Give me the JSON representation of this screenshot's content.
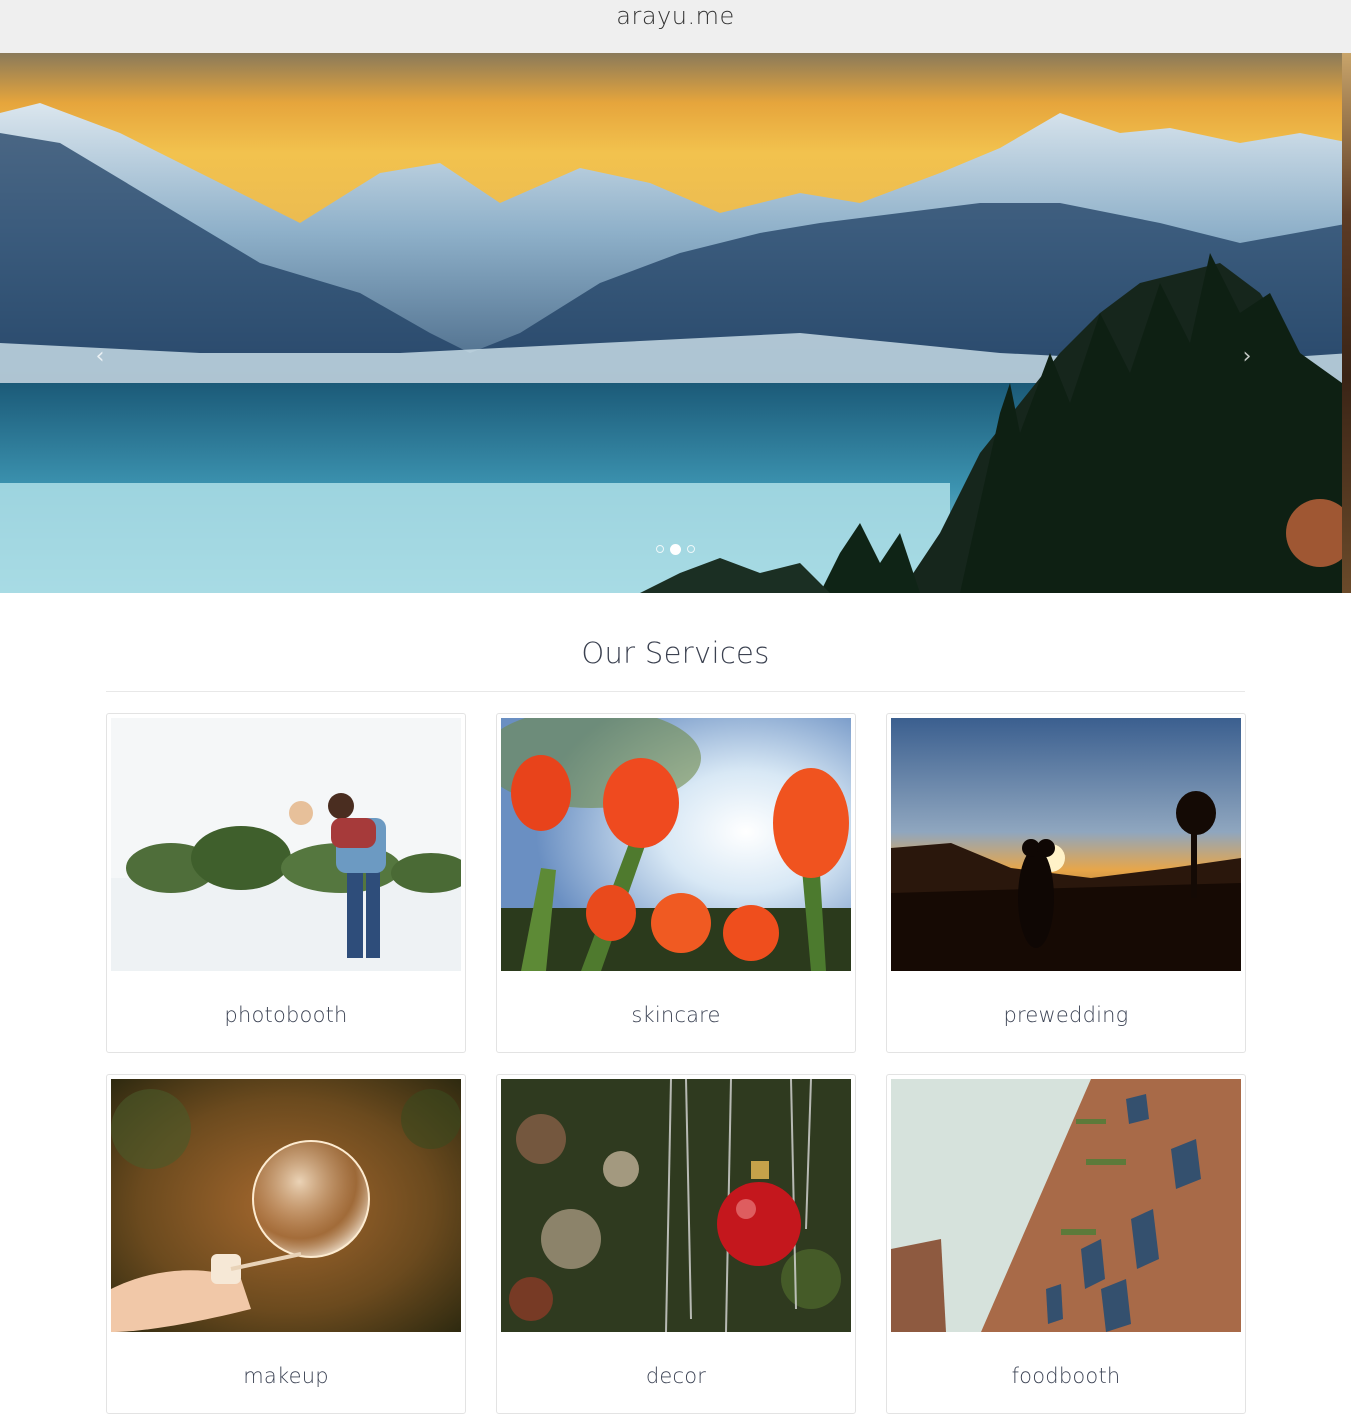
{
  "header": {
    "brand": "arayu.me"
  },
  "hero": {
    "carousel_prev": "‹",
    "carousel_next": "›",
    "slide_count": 3,
    "active_slide": 2
  },
  "services": {
    "title": "Our Services",
    "items": [
      {
        "label": "photobooth"
      },
      {
        "label": "skincare"
      },
      {
        "label": "prewedding"
      },
      {
        "label": "makeup"
      },
      {
        "label": "decor"
      },
      {
        "label": "foodbooth"
      }
    ]
  }
}
